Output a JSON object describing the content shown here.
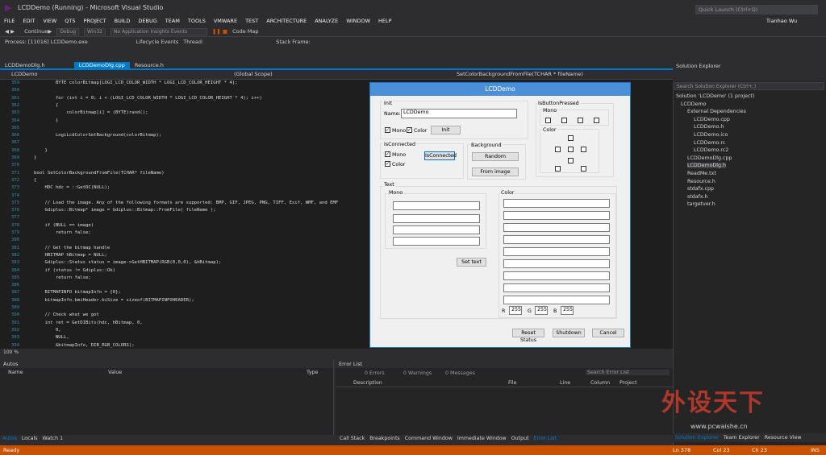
{
  "window": {
    "title": "LCDDemo (Running) - Microsoft Visual Studio",
    "quick_launch": "Quick Launch (Ctrl+Q)",
    "user": "Tianhao Wu"
  },
  "menu": [
    "FILE",
    "EDIT",
    "VIEW",
    "QT5",
    "PROJECT",
    "BUILD",
    "DEBUG",
    "TEAM",
    "TOOLS",
    "VMWARE",
    "TEST",
    "ARCHITECTURE",
    "ANALYZE",
    "WINDOW",
    "HELP"
  ],
  "toolbar": {
    "continue": "Continue",
    "config": "Debug",
    "platform": "Win32",
    "insights": "No Application Insights Events",
    "codemap": "Code Map"
  },
  "procbar": {
    "process": "Process: [11016] LCDDemo.exe",
    "lifecycle": "Lifecycle Events",
    "thread": "Thread:",
    "stackframe": "Stack Frame:"
  },
  "doctabs": [
    "LCDDemoDlg.h",
    "LCDDemoDlg.cpp",
    "Resource.h"
  ],
  "nav": {
    "project": "LCDDemo",
    "scope": "(Global Scope)",
    "member": "SetColorBackgroundFromFile(TCHAR * fileName)"
  },
  "code": [
    {
      "n": "359",
      "t": "        BYTE colorBitmap[LOGI_LCD_COLOR_WIDTH * LOGI_LCD_COLOR_HEIGHT * 4];"
    },
    {
      "n": "360",
      "t": ""
    },
    {
      "n": "361",
      "t": "        for (int i = 0; i < (LOGI_LCD_COLOR_WIDTH * LOGI_LCD_COLOR_HEIGHT * 4); i++)"
    },
    {
      "n": "362",
      "t": "        {"
    },
    {
      "n": "363",
      "t": "            colorBitmap[i] = (BYTE)rand();"
    },
    {
      "n": "364",
      "t": "        }"
    },
    {
      "n": "365",
      "t": ""
    },
    {
      "n": "366",
      "t": "        LogiLcdColorSetBackground(colorBitmap);"
    },
    {
      "n": "367",
      "t": ""
    },
    {
      "n": "368",
      "t": "    }"
    },
    {
      "n": "369",
      "t": "}"
    },
    {
      "n": "370",
      "t": ""
    },
    {
      "n": "371",
      "t": "bool SetColorBackgroundFromFile(TCHAR* fileName)"
    },
    {
      "n": "372",
      "t": "{"
    },
    {
      "n": "373",
      "t": "    HDC hdc = ::GetDC(NULL);"
    },
    {
      "n": "374",
      "t": ""
    },
    {
      "n": "375",
      "t": "    // Load the image. Any of the following formats are supported: BMP, GIF, JPEG, PNG, TIFF, Exif, WMF, and EMF"
    },
    {
      "n": "376",
      "t": "    Gdiplus::Bitmap* image = Gdiplus::Bitmap::FromFile( fileName );"
    },
    {
      "n": "377",
      "t": ""
    },
    {
      "n": "378",
      "t": "    if (NULL == image)"
    },
    {
      "n": "379",
      "t": "        return false;"
    },
    {
      "n": "380",
      "t": ""
    },
    {
      "n": "381",
      "t": "    // Get the bitmap handle"
    },
    {
      "n": "382",
      "t": "    HBITMAP hBitmap = NULL;"
    },
    {
      "n": "383",
      "t": "    Gdiplus::Status status = image->GetHBITMAP(RGB(0,0,0), &hBitmap);"
    },
    {
      "n": "384",
      "t": "    if (status != Gdiplus::Ok)"
    },
    {
      "n": "385",
      "t": "        return false;"
    },
    {
      "n": "386",
      "t": ""
    },
    {
      "n": "387",
      "t": "    BITMAPINFO bitmapInfo = {0};"
    },
    {
      "n": "388",
      "t": "    bitmapInfo.bmiHeader.biSize = sizeof(BITMAPINFOHEADER);"
    },
    {
      "n": "389",
      "t": ""
    },
    {
      "n": "390",
      "t": "    // Check what we got"
    },
    {
      "n": "391",
      "t": "    int ret = GetDIBits(hdc, hBitmap, 0,"
    },
    {
      "n": "392",
      "t": "        0,"
    },
    {
      "n": "393",
      "t": "        NULL,"
    },
    {
      "n": "394",
      "t": "        &bitmapInfo, DIB_RGB_COLORS);"
    },
    {
      "n": "395",
      "t": ""
    },
    {
      "n": "396",
      "t": "    if (LOGI_LCD_COLOR_WIDTH != bitmapInfo.bmiHeader.biWidth || LOGI_LCD_COLOR_HEIGHT != bitmapInfo.bmiHeader.bi"
    },
    {
      "n": "397",
      "t": "    {"
    }
  ],
  "zoom": "100 %",
  "dialog": {
    "title": "LCDDemo",
    "init_group": "Init",
    "name_label": "Name:",
    "name_value": "LCDDemo",
    "mono": "Mono",
    "color": "Color",
    "init_btn": "Init",
    "isconnected": "IsConnected",
    "isconnected_btn": "IsConnected",
    "background": "Background",
    "random_btn": "Random",
    "fromimage_btn": "From image",
    "isbuttonpressed": "IsButtonPressed",
    "text_group": "Text",
    "text_mono": "Mono",
    "text_color": "Color",
    "settext_btn": "Set text",
    "r": "R",
    "g": "G",
    "b": "B",
    "rv": "255",
    "gv": "255",
    "bv": "255",
    "reset_btn": "Reset Status",
    "shutdown_btn": "Shutdown",
    "cancel_btn": "Cancel"
  },
  "solution": {
    "title": "Solution Explorer",
    "search": "Search Solution Explorer (Ctrl+;)",
    "items": [
      "Solution 'LCDDemo' (1 project)",
      "LCDDemo",
      "External Dependencies",
      "LCDDemo.cpp",
      "LCDDemo.h",
      "LCDDemo.ico",
      "LCDDemo.rc",
      "LCDDemo.rc2",
      "LCDDemoDlg.cpp",
      "LCDDemoDlg.h",
      "ReadMe.txt",
      "Resource.h",
      "stdafx.cpp",
      "stdafx.h",
      "targetver.h"
    ],
    "tabs": [
      "Solution Explorer",
      "Team Explorer",
      "Resource View"
    ]
  },
  "autos": {
    "title": "Autos",
    "name": "Name",
    "value": "Value",
    "type": "Type",
    "tabs": [
      "Autos",
      "Locals",
      "Watch 1"
    ]
  },
  "errors": {
    "title": "Error List",
    "errors": "0 Errors",
    "warnings": "0 Warnings",
    "messages": "0 Messages",
    "search": "Search Error List",
    "cols": [
      "Description",
      "File",
      "Line",
      "Column",
      "Project"
    ],
    "tabs": [
      "Call Stack",
      "Breakpoints",
      "Command Window",
      "Immediate Window",
      "Output",
      "Error List"
    ]
  },
  "status": {
    "ready": "Ready",
    "ln": "Ln 378",
    "col": "Col 23",
    "ch": "Ch 23",
    "ins": "INS"
  },
  "watermark": {
    "text": "外设天下",
    "url": "www.pcwaishe.cn"
  }
}
